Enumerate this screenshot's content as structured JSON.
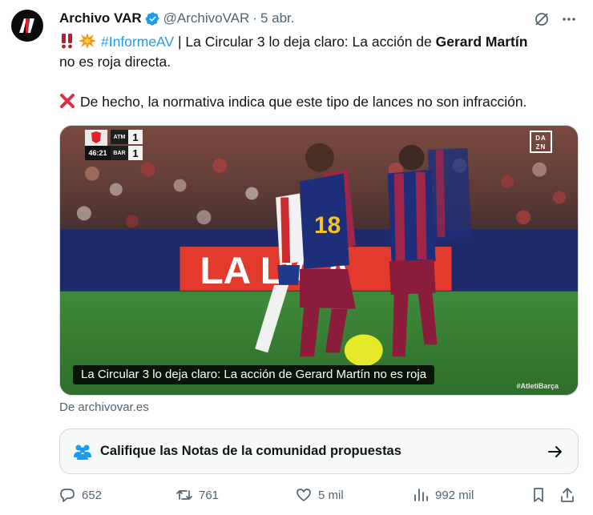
{
  "author": {
    "name": "Archivo VAR",
    "handle": "@ArchivoVAR",
    "separator": "·",
    "date": "5 abr."
  },
  "tweet": {
    "hashtag": "#InformeAV",
    "line1_rest": " | La Circular 3 lo deja claro: La acción de ",
    "line1_bold": "Gerard Martín",
    "line2": "no es roja directa.",
    "line3": "De hecho, la normativa indica que este tipo de lances no son infracción."
  },
  "media": {
    "scoreboard": {
      "time": "46:21",
      "home_team": "ATM",
      "home_goals": "1",
      "away_team": "BAR",
      "away_goals": "1"
    },
    "broadcaster": "DA ZN",
    "caption": "La Circular 3 lo deja claro: La acción de Gerard Martín no es roja",
    "overlay_hashtag": "#AtletiBarça"
  },
  "source": "De archivovar.es",
  "community_notes": {
    "label": "Califique las Notas de la comunidad propuestas"
  },
  "actions": {
    "replies": "652",
    "reposts": "761",
    "likes": "5 mil",
    "views": "992 mil"
  },
  "colors": {
    "accent": "#1d9bf0",
    "secondary_text": "#536471",
    "primary_text": "#0f1419"
  },
  "icons": [
    "verified-icon",
    "grok-icon",
    "more-icon",
    "double-exclamation-emoji",
    "collision-emoji",
    "cross-mark-emoji",
    "people-icon",
    "arrow-right-icon",
    "reply-icon",
    "repost-icon",
    "like-icon",
    "views-icon",
    "bookmark-icon",
    "share-icon"
  ]
}
